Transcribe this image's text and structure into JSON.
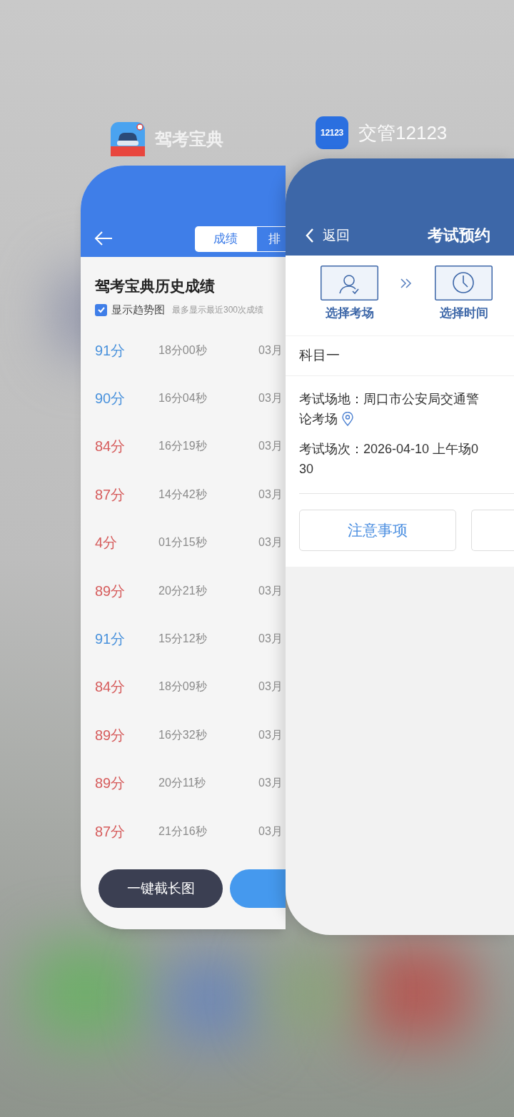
{
  "left_app": {
    "app_name": "驾考宝典",
    "tabs": [
      {
        "label": "成绩",
        "selected": true
      },
      {
        "label": "排",
        "selected": false
      }
    ],
    "title": "驾考宝典历史成绩",
    "trend_checkbox": {
      "label": "显示趋势图",
      "checked": true
    },
    "note": "最多显示最近300次成绩",
    "records": [
      {
        "score": "91分",
        "color": "#4a92dc",
        "duration": "18分00秒",
        "date": "03月"
      },
      {
        "score": "90分",
        "color": "#4a92dc",
        "duration": "16分04秒",
        "date": "03月"
      },
      {
        "score": "84分",
        "color": "#d65c5c",
        "duration": "16分19秒",
        "date": "03月"
      },
      {
        "score": "87分",
        "color": "#d65c5c",
        "duration": "14分42秒",
        "date": "03月"
      },
      {
        "score": "4分",
        "color": "#d65c5c",
        "duration": "01分15秒",
        "date": "03月"
      },
      {
        "score": "89分",
        "color": "#d65c5c",
        "duration": "20分21秒",
        "date": "03月"
      },
      {
        "score": "91分",
        "color": "#4a92dc",
        "duration": "15分12秒",
        "date": "03月"
      },
      {
        "score": "84分",
        "color": "#d65c5c",
        "duration": "18分09秒",
        "date": "03月"
      },
      {
        "score": "89分",
        "color": "#d65c5c",
        "duration": "16分32秒",
        "date": "03月"
      },
      {
        "score": "89分",
        "color": "#d65c5c",
        "duration": "20分11秒",
        "date": "03月"
      },
      {
        "score": "87分",
        "color": "#d65c5c",
        "duration": "21分16秒",
        "date": "03月"
      }
    ],
    "buttons": [
      "一键截长图"
    ]
  },
  "right_app": {
    "app_name": "交管12123",
    "icon_text": "12123",
    "back_label": "返回",
    "title": "考试预约",
    "steps": [
      {
        "kind": "venue",
        "label": "选择考场"
      },
      {
        "kind": "time",
        "label": "选择时间"
      }
    ],
    "subject": "科目一",
    "details": [
      {
        "kind": "venue",
        "lines": [
          "考试场地：周口市公安局交通警",
          "论考场"
        ]
      },
      {
        "kind": "session",
        "lines": [
          "考试场次：2026-04-10 上午场0",
          "30"
        ]
      }
    ],
    "buttons": [
      "注意事项"
    ]
  }
}
